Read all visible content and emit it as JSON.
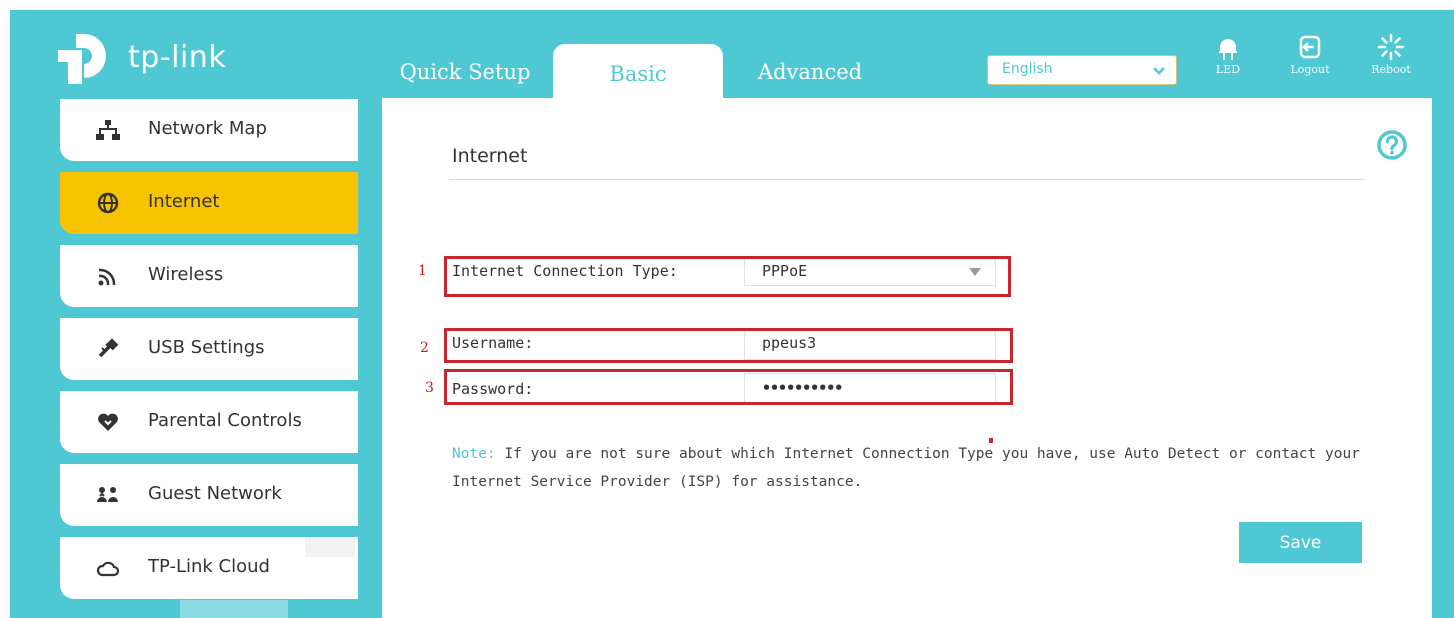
{
  "brand": {
    "name": "tp-link",
    "color": "#4ec8d3"
  },
  "tabs": [
    {
      "label": "Quick Setup",
      "active": false
    },
    {
      "label": "Basic",
      "active": true
    },
    {
      "label": "Advanced",
      "active": false
    }
  ],
  "language": {
    "value": "English",
    "icon": "chevron-down-icon"
  },
  "top_actions": [
    {
      "label": "LED",
      "icon": "led-icon"
    },
    {
      "label": "Logout",
      "icon": "logout-icon"
    },
    {
      "label": "Reboot",
      "icon": "reboot-icon"
    }
  ],
  "sidebar": {
    "items": [
      {
        "label": "Network Map",
        "icon": "network-map-icon",
        "active": false
      },
      {
        "label": "Internet",
        "icon": "globe-icon",
        "active": true
      },
      {
        "label": "Wireless",
        "icon": "wireless-icon",
        "active": false
      },
      {
        "label": "USB Settings",
        "icon": "usb-icon",
        "active": false
      },
      {
        "label": "Parental Controls",
        "icon": "heart-icon",
        "active": false
      },
      {
        "label": "Guest Network",
        "icon": "guest-icon",
        "active": false
      },
      {
        "label": "TP-Link Cloud",
        "icon": "cloud-icon",
        "active": false
      }
    ],
    "active_color": "#f8c400"
  },
  "main": {
    "title": "Internet",
    "help_icon": "help-icon",
    "fields": [
      {
        "number": "1",
        "label": "Internet Connection Type:",
        "value": "PPPoE",
        "type": "select"
      },
      {
        "number": "2",
        "label": "Username:",
        "value": "ppeus3",
        "type": "text"
      },
      {
        "number": "3",
        "label": "Password:",
        "value": "••••••••••",
        "type": "password"
      }
    ],
    "note_label": "Note:",
    "note_text_1": " If you are not sure about which Internet Connection Type you have, use Auto Detect or contact your",
    "note_text_2": "Internet Service Provider (ISP) for assistance.",
    "save_label": "Save",
    "highlight_color": "#c9252c"
  }
}
